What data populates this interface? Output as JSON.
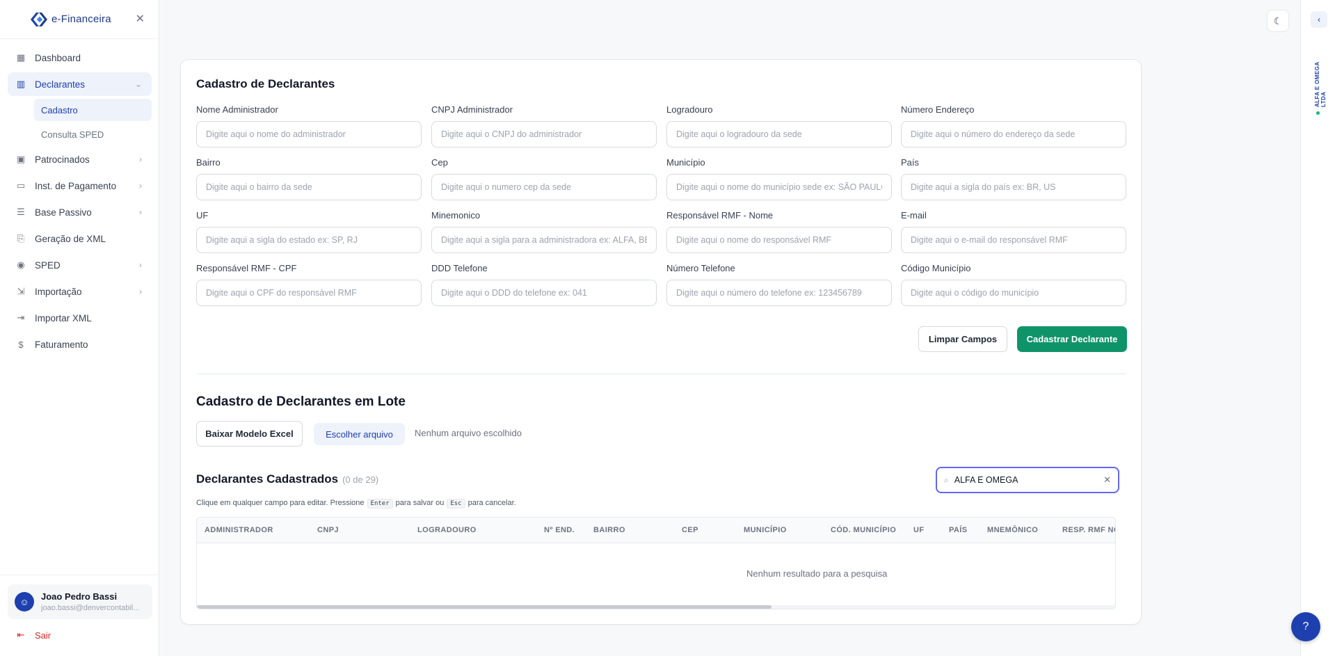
{
  "brand": {
    "name": "e-Financeira"
  },
  "sidebar": {
    "items": [
      {
        "label": "Dashboard"
      },
      {
        "label": "Declarantes"
      },
      {
        "label": "Patrocinados"
      },
      {
        "label": "Inst. de Pagamento"
      },
      {
        "label": "Base Passivo"
      },
      {
        "label": "Geração de XML"
      },
      {
        "label": "SPED"
      },
      {
        "label": "Importação"
      },
      {
        "label": "Importar XML"
      },
      {
        "label": "Faturamento"
      }
    ],
    "sub_items": [
      {
        "label": "Cadastro"
      },
      {
        "label": "Consulta SPED"
      }
    ]
  },
  "user": {
    "name": "Joao Pedro Bassi",
    "email": "joao.bassi@denvercontabil..."
  },
  "logout_label": "Sair",
  "company_vertical": "ALFA E OMEGA LTDA",
  "form": {
    "title": "Cadastro de Declarantes",
    "fields": [
      {
        "label": "Nome Administrador",
        "placeholder": "Digite aqui o nome do administrador"
      },
      {
        "label": "CNPJ Administrador",
        "placeholder": "Digite aqui o CNPJ do administrador"
      },
      {
        "label": "Logradouro",
        "placeholder": "Digite aqui o logradouro da sede"
      },
      {
        "label": "Número Endereço",
        "placeholder": "Digite aqui o número do endereço da sede"
      },
      {
        "label": "Bairro",
        "placeholder": "Digite aqui o bairro da sede"
      },
      {
        "label": "Cep",
        "placeholder": "Digite aqui o numero cep da sede"
      },
      {
        "label": "Município",
        "placeholder": "Digite aqui o nome do município sede ex: SÃO PAULO"
      },
      {
        "label": "País",
        "placeholder": "Digite aqui a sigla do país ex: BR, US"
      },
      {
        "label": "UF",
        "placeholder": "Digite aqui a sigla do estado ex: SP, RJ"
      },
      {
        "label": "Minemonico",
        "placeholder": "Digite aqui a sigla para a administradora ex: ALFA, BETA"
      },
      {
        "label": "Responsável RMF - Nome",
        "placeholder": "Digite aqui o nome do responsável RMF"
      },
      {
        "label": "E-mail",
        "placeholder": "Digite aqui o e-mail do responsável RMF"
      },
      {
        "label": "Responsável RMF - CPF",
        "placeholder": "Digite aqui o CPF do responsável RMF"
      },
      {
        "label": "DDD Telefone",
        "placeholder": "Digite aqui o DDD do telefone ex: 041"
      },
      {
        "label": "Número Telefone",
        "placeholder": "Digite aqui o número do telefone ex: 123456789"
      },
      {
        "label": "Código Município",
        "placeholder": "Digite aqui o código do município"
      }
    ],
    "clear_label": "Limpar Campos",
    "submit_label": "Cadastrar Declarante"
  },
  "batch": {
    "title": "Cadastro de Declarantes em Lote",
    "download_label": "Baixar Modelo Excel",
    "choose_label": "Escolher arquivo",
    "no_file": "Nenhum arquivo escolhido"
  },
  "list": {
    "title": "Declarantes Cadastrados",
    "count": "(0 de 29)",
    "hint_before": "Clique em qualquer campo para editar. Pressione",
    "hint_enter": "Enter",
    "hint_middle": "para salvar ou",
    "hint_esc": "Esc",
    "hint_after": "para cancelar.",
    "search_value": "ALFA E OMEGA",
    "columns": [
      "ADMINISTRADOR",
      "CNPJ",
      "LOGRADOURO",
      "Nº END.",
      "BAIRRO",
      "CEP",
      "MUNICÍPIO",
      "CÓD. MUNICÍPIO",
      "UF",
      "PAÍS",
      "MNEMÔNICO",
      "RESP. RMF NO"
    ],
    "empty_text": "Nenhum resultado para a pesquisa"
  }
}
